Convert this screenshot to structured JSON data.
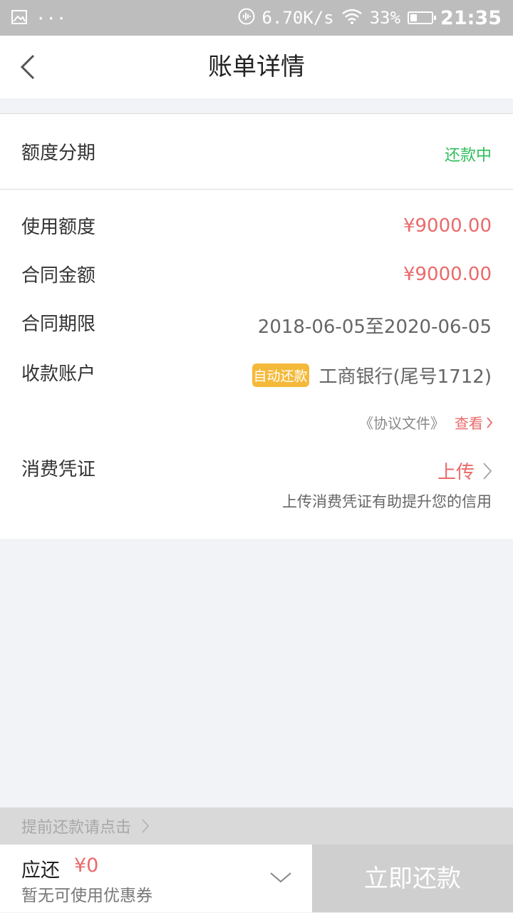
{
  "status_bar": {
    "icons": [
      "image-icon",
      "more-icon",
      "voice-icon",
      "wifi-icon",
      "battery-icon"
    ],
    "more": "···",
    "speed": "6.70K/s",
    "battery": "33%",
    "battery_level": 0.33,
    "time": "21:35"
  },
  "nav": {
    "title": "账单详情",
    "back_icon": "chevron-left-icon"
  },
  "summary": {
    "type_label": "额度分期",
    "status": "还款中",
    "status_color": "#2fbf5b"
  },
  "details": {
    "used_label": "使用额度",
    "used_value": "¥9000.00",
    "contract_amount_label": "合同金额",
    "contract_amount_value": "¥9000.00",
    "term_label": "合同期限",
    "term_value": "2018-06-05至2020-06-05",
    "account_label": "收款账户",
    "auto_badge": "自动还款",
    "account_value": "工商银行(尾号1712)",
    "agreement_text": "《协议文件》",
    "agreement_view": "查看",
    "voucher_label": "消费凭证",
    "voucher_action": "上传",
    "voucher_tip": "上传消费凭证有助提升您的信用"
  },
  "prepay": {
    "text": "提前还款请点击"
  },
  "footer": {
    "due_label": "应还",
    "due_amount": "¥0",
    "coupon_text": "暂无可使用优惠券",
    "pay_button": "立即还款"
  },
  "colors": {
    "accent_red": "#ea6a6a",
    "badge_yellow": "#f5b93a",
    "disabled_button": "#cfcfcf"
  }
}
